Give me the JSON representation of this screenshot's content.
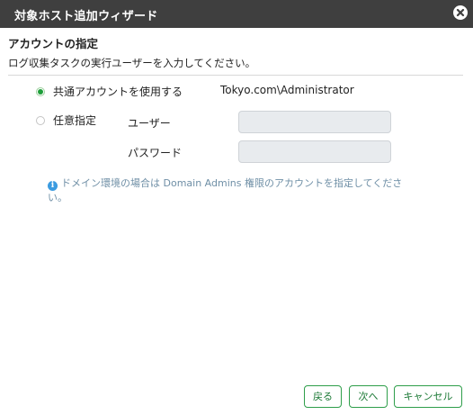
{
  "window": {
    "title": "対象ホスト追加ウィザード"
  },
  "section": {
    "title": "アカウントの指定",
    "description": "ログ収集タスクの実行ユーザーを入力してください。"
  },
  "account_options": {
    "shared_label": "共通アカウントを使用する",
    "shared_checked": true,
    "shared_account": "Tokyo.com\\Administrator",
    "custom_label": "任意指定",
    "custom_checked": false
  },
  "fields": {
    "user_label": "ユーザー",
    "user_value": "",
    "password_label": "パスワード",
    "password_value": ""
  },
  "info": {
    "icon": "info-icon",
    "text": "ドメイン環境の場合は Domain Admins 権限のアカウントを指定してください。"
  },
  "buttons": {
    "back": "戻る",
    "next": "次へ",
    "cancel": "キャンセル"
  },
  "colors": {
    "titlebar": "#3f3f3f",
    "accent_green": "#1e9e3a",
    "info_blue": "#3b9be0"
  }
}
